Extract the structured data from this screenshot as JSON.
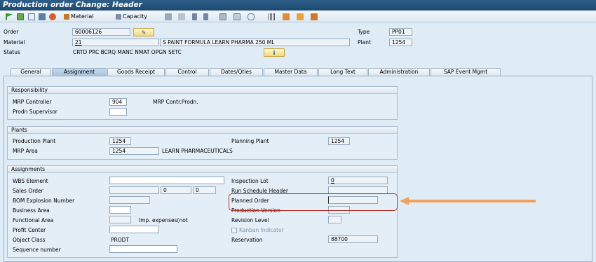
{
  "window": {
    "title": "Production order Change: Header"
  },
  "toolbar": {
    "material_label": "Material",
    "capacity_label": "Capacity"
  },
  "header": {
    "order_label": "Order",
    "order_value": "60006126",
    "type_label": "Type",
    "type_value": "PP01",
    "material_label": "Material",
    "material_value": "21",
    "material_desc": "S PAINT FORMULA LEARN PHARMA 250 ML",
    "plant_label": "Plant",
    "plant_value": "1254",
    "status_label": "Status",
    "status_value": "CRTD PRC  BCRQ MANC NMAT OPGN SETC"
  },
  "tabs": [
    "General",
    "Assignment",
    "Goods Receipt",
    "Control",
    "Dates/Qties",
    "Master Data",
    "Long Text",
    "Administration",
    "SAP Event Mgmt"
  ],
  "responsibility": {
    "title": "Responsibility",
    "mrp_controller_label": "MRP Controller",
    "mrp_controller_value": "904",
    "mrp_controller_desc": "MRP Contr.Prodn.",
    "prodn_supervisor_label": "Prodn Supervisor",
    "prodn_supervisor_value": ""
  },
  "plants": {
    "title": "Plants",
    "production_plant_label": "Production Plant",
    "production_plant_value": "1254",
    "planning_plant_label": "Planning Plant",
    "planning_plant_value": "1254",
    "mrp_area_label": "MRP Area",
    "mrp_area_value": "1254",
    "mrp_area_desc": "LEARN PHARMACEUTICALS"
  },
  "assignments": {
    "title": "Assignments",
    "wbs_label": "WBS Element",
    "wbs_value": "",
    "sales_order_label": "Sales Order",
    "sales_order_value": "",
    "sales_item": "0",
    "sales_sched": "0",
    "bom_label": "BOM Explosion Number",
    "bom_value": "",
    "business_area_label": "Business Area",
    "business_area_value": "",
    "functional_area_label": "Functional Area",
    "functional_area_value": "",
    "imp_expenses_label": "Imp. expenses(not",
    "profit_center_label": "Profit Center",
    "profit_center_value": "",
    "object_class_label": "Object Class",
    "object_class_value": "PRODT",
    "sequence_label": "Sequence number",
    "sequence_value": "",
    "inspection_lot_label": "Inspection Lot",
    "inspection_lot_value": "0",
    "run_schedule_label": "Run Schedule Header",
    "run_schedule_value": "",
    "planned_order_label": "Planned Order",
    "planned_order_value": "",
    "production_version_label": "Production Version",
    "production_version_value": "",
    "revision_level_label": "Revision Level",
    "revision_level_value": "",
    "kanban_label": "Kanban Indicator",
    "reservation_label": "Reservation",
    "reservation_value": "88700"
  },
  "annotation": {
    "highlight_color": "#b3322b",
    "arrow_color": "#f0a35e"
  }
}
